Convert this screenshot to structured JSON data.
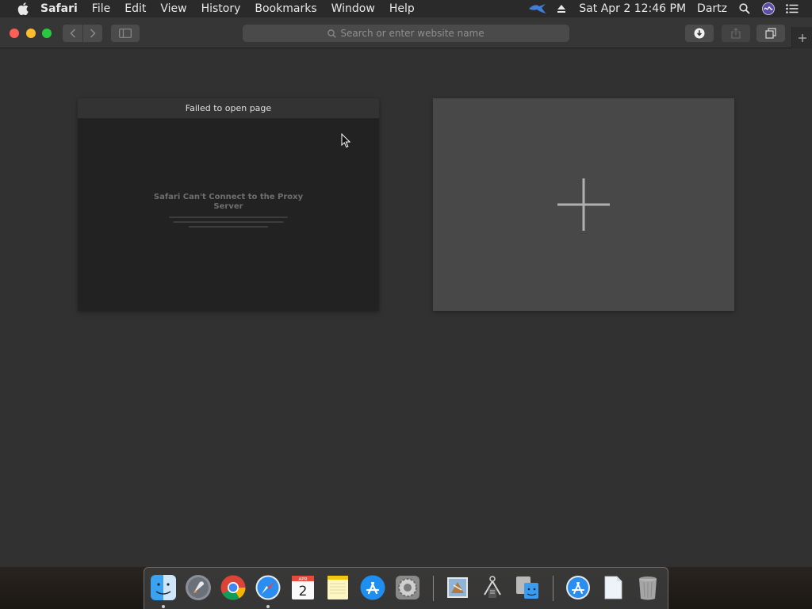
{
  "menubar": {
    "app_name": "Safari",
    "items": [
      "File",
      "Edit",
      "View",
      "History",
      "Bookmarks",
      "Window",
      "Help"
    ],
    "datetime": "Sat Apr 2  12:46 PM",
    "user": "Dartz",
    "icons": [
      "apple-icon",
      "bird-status-icon",
      "eject-icon",
      "spotlight-search-icon",
      "siri-icon",
      "notification-center-icon"
    ]
  },
  "toolbar": {
    "address_placeholder": "Search or enter website name"
  },
  "tabs": {
    "failed": {
      "title": "Failed to open page",
      "error_heading": "Safari Can't Connect to the Proxy Server"
    }
  },
  "dock": {
    "apps": [
      "finder",
      "launchpad",
      "chrome",
      "safari",
      "calendar",
      "notes",
      "app-store",
      "system-preferences",
      "mail-preview",
      "xcode-instruments",
      "migration-assistant",
      "app-store-downloads",
      "documents",
      "trash"
    ],
    "calendar_month": "APR",
    "calendar_day": "2"
  },
  "colors": {
    "close": "#fc5f57",
    "minimize": "#fdbc2e",
    "zoom": "#28c840"
  }
}
